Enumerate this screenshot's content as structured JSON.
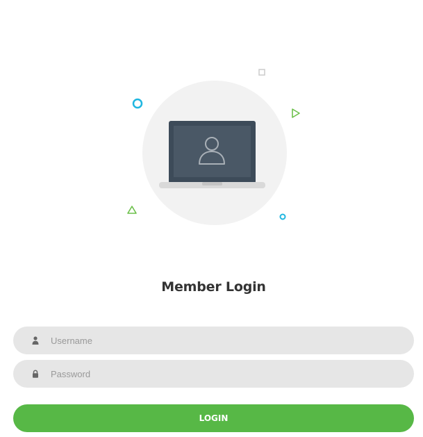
{
  "login": {
    "title": "Member Login",
    "username_placeholder": "Username",
    "password_placeholder": "Password",
    "submit_label": "LOGIN"
  },
  "colors": {
    "accent_green": "#57b846",
    "decor_blue": "#1fb6e0",
    "input_background": "#e6e6e6",
    "laptop_dark": "#3d4b59"
  },
  "icons": {
    "username": "user-icon",
    "password": "lock-icon",
    "illustration": "laptop-user-icon"
  }
}
